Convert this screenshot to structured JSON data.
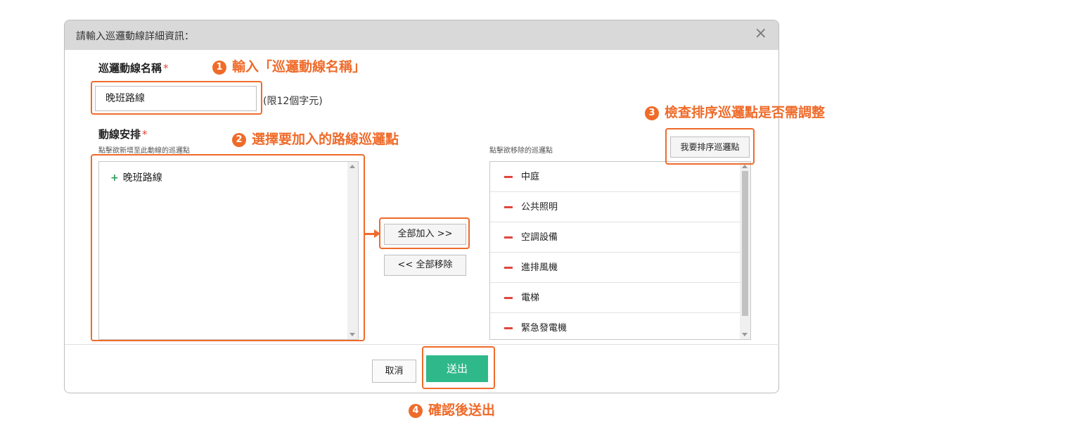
{
  "dialog": {
    "title": "請輸入巡邏動線詳細資訊：",
    "close_glyph": "×"
  },
  "name_field": {
    "label": "巡邏動線名稱",
    "required_mark": "*",
    "value": "晚班路線",
    "limit_note": "(限12個字元)"
  },
  "route": {
    "label": "動線安排",
    "required_mark": "*",
    "left_hint": "點擊欲新增至此動線的巡邏點",
    "right_hint": "點擊欲移除的巡邏點",
    "left_items": [
      {
        "icon": "plus-icon",
        "label": "晚班路線"
      }
    ],
    "right_items": [
      {
        "icon": "minus-icon",
        "label": "中庭"
      },
      {
        "icon": "minus-icon",
        "label": "公共照明"
      },
      {
        "icon": "minus-icon",
        "label": "空調設備"
      },
      {
        "icon": "minus-icon",
        "label": "進排風機"
      },
      {
        "icon": "minus-icon",
        "label": "電梯"
      },
      {
        "icon": "minus-icon",
        "label": "緊急發電機"
      }
    ]
  },
  "buttons": {
    "add_all": "全部加入 >>",
    "remove_all": "<< 全部移除",
    "sort": "我要排序巡邏點",
    "cancel": "取消",
    "submit": "送出"
  },
  "annotations": {
    "step1": {
      "num": "1",
      "text": "輸入「巡邏動線名稱」"
    },
    "step2": {
      "num": "2",
      "text": "選擇要加入的路線巡邏點"
    },
    "step3": {
      "num": "3",
      "text": "檢查排序巡邏點是否需調整"
    },
    "step4": {
      "num": "4",
      "text": "確認後送出"
    }
  },
  "colors": {
    "accent_orange": "#ef6b2a",
    "submit_green": "#2fb88a",
    "minus_red": "#e0463c",
    "plus_green": "#2e9e5a"
  }
}
